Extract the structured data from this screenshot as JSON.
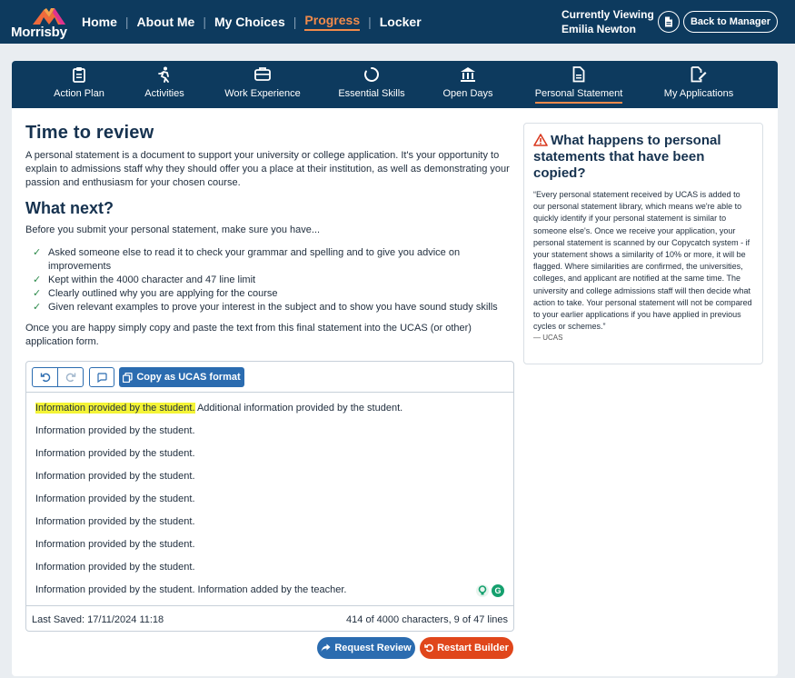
{
  "brand": {
    "name": "Morrisby"
  },
  "mainnav": {
    "items": [
      {
        "label": "Home"
      },
      {
        "label": "About Me"
      },
      {
        "label": "My Choices"
      },
      {
        "label": "Progress"
      },
      {
        "label": "Locker"
      }
    ],
    "active": "Progress"
  },
  "viewing": {
    "label": "Currently Viewing",
    "name": "Emilia Newton"
  },
  "header": {
    "back_label": "Back to Manager"
  },
  "subnav": {
    "items": [
      {
        "label": "Action Plan",
        "icon": "clipboard-icon"
      },
      {
        "label": "Activities",
        "icon": "person-running-icon"
      },
      {
        "label": "Work Experience",
        "icon": "briefcase-icon"
      },
      {
        "label": "Essential Skills",
        "icon": "circle-notch-icon"
      },
      {
        "label": "Open Days",
        "icon": "institution-icon"
      },
      {
        "label": "Personal Statement",
        "icon": "document-icon"
      },
      {
        "label": "My Applications",
        "icon": "edit-document-icon"
      }
    ],
    "active": "Personal Statement"
  },
  "content": {
    "title": "Time to review",
    "intro": "A personal statement is a document to support your university or college application. It's your opportunity to explain to admissions staff why they should offer you a place at their institution, as well as demonstrating your passion and enthusiasm for your chosen course.",
    "next_title": "What next?",
    "before_text": "Before you submit your personal statement, make sure you have...",
    "checklist": [
      "Asked someone else to read it to check your grammar and spelling and to give you advice on improvements",
      "Kept within the 4000 character and 47 line limit",
      "Clearly outlined why you are applying for the course",
      "Given relevant examples to prove your interest in the subject and to show you have sound study skills"
    ],
    "outro": "Once you are happy simply copy and paste the text from this final statement into the UCAS (or other) application form."
  },
  "editor": {
    "copy_label": "Copy as UCAS format",
    "lines": [
      {
        "highlight": "Information provided by the student.",
        "text": " Additional information provided by the student."
      },
      {
        "text": "Information provided by the student."
      },
      {
        "text": "Information provided by the student."
      },
      {
        "text": "Information provided by the student."
      },
      {
        "text": "Information provided by the student."
      },
      {
        "text": "Information provided by the student."
      },
      {
        "text": "Information provided by the student."
      },
      {
        "text": "Information provided by the student."
      },
      {
        "text": "Information provided by the student. Information added by the teacher."
      }
    ],
    "last_saved": "Last Saved: 17/11/2024 11:18",
    "count": "414 of 4000 characters, 9 of 47 lines"
  },
  "actions": {
    "request_review": "Request Review",
    "restart_builder": "Restart Builder"
  },
  "sidebar": {
    "title": "What happens to personal statements that have been copied?",
    "quote": "“Every personal statement received by UCAS is added to our personal statement library, which means we're able to quickly identify if your personal statement is similar to someone else's. Once we receive your application, your personal statement is scanned by our Copycatch system - if your statement shows a similarity of 10% or more, it will be flagged. Where similarities are confirmed, the universities, colleges, and applicant are notified at the same time. The university and college admissions staff will then decide what action to take. Your personal statement will not be compared to your earlier applications if you have applied in previous cycles or schemes.”",
    "source": "— UCAS"
  },
  "colors": {
    "navy": "#0d3a5e",
    "accent": "#f08a4b",
    "primary": "#2b6cb0",
    "danger": "#e0461b",
    "highlight": "#f4f436",
    "success": "#2c8a4a"
  }
}
